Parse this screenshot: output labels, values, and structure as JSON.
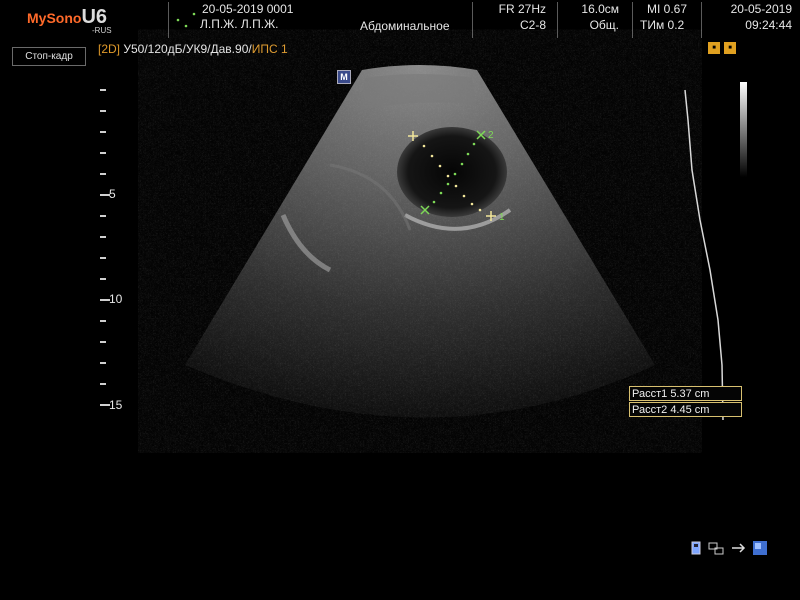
{
  "header": {
    "logo_main": "MySono",
    "logo_model": "U6",
    "logo_sub": "-RUS",
    "patient_date_id": "20-05-2019 0001",
    "patient_name": "Л.П.Ж.  Л.П.Ж.",
    "preset": "Абдоминальное",
    "frame_rate": "FR 27Hz",
    "probe": "C2-8",
    "depth": "16.0см",
    "app": "Общ.",
    "mi": "MI  0.67",
    "tim": "ТИм 0.2",
    "date": "20-05-2019",
    "time": "09:24:44"
  },
  "status": {
    "freeze_label": "Стоп-кадр",
    "mode": "[2D]",
    "params": " У50/120дБ/УК9/Дав.90/",
    "ips": "ИПС 1"
  },
  "ruler": {
    "labels": [
      "5",
      "10",
      "15"
    ]
  },
  "markers": {
    "m_icon": "M",
    "caliper1_label": "1",
    "caliper2_label": "2"
  },
  "measurements": [
    {
      "label": "Расст1",
      "value": "5.37 cm"
    },
    {
      "label": "Расст2",
      "value": "4.45 cm"
    }
  ],
  "icons": [
    "usb-icon",
    "network-icon",
    "printer-icon",
    "storage-icon"
  ],
  "colors": {
    "accent_orange": "#ff6a2a",
    "mode_orange": "#e09a2a",
    "caliper_green": "#7ed957",
    "caliper_yellow": "#f3e79b"
  }
}
